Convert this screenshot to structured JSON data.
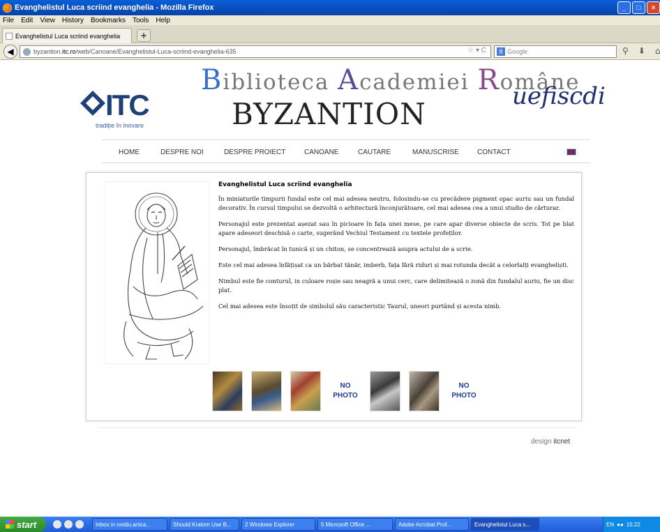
{
  "window": {
    "title": "Evanghelistul Luca scriind evanghelia - Mozilla Firefox"
  },
  "menu": [
    "File",
    "Edit",
    "View",
    "History",
    "Bookmarks",
    "Tools",
    "Help"
  ],
  "tab": {
    "label": "Evanghelistul Luca scriind evanghelia"
  },
  "url": {
    "prefix": "byzantion.",
    "domain": "itc.ro",
    "path": "/web/Canoane/Evanghelistul-Luca-scriind-evanghelia-635"
  },
  "search": {
    "placeholder": "Google"
  },
  "site": {
    "itc_logo": "ITC",
    "itc_tagline": "tradiție în inovare",
    "library": "Biblioteca Academiei Române",
    "library_caps": [
      "B",
      "A",
      "R"
    ],
    "library_rest": [
      "iblioteca ",
      "cademiei ",
      "omâne"
    ],
    "title": "BYZANTION",
    "uefiscdi": "uefiscdi"
  },
  "nav": [
    "HOME",
    "DESPRE NOI",
    "DESPRE PROIECT",
    "CANOANE",
    "CAUTARE",
    "MANUSCRISE",
    "CONTACT"
  ],
  "article": {
    "title": "Evanghelistul Luca scriind evanghelia",
    "paragraphs": [
      "În miniaturile timpurii fundal este cel mai adesea neutru, folosindu-se cu precădere pigment opac auriu sau un fundal decorativ. În cursul timpului se dezvoltă o arhitectură înconjurătoare, cel mai adesea cea a unui studio de cărturar.",
      "Personajul este prezentat așezat sau în picioare în fața unei mese, pe care apar diverse obiecte de scris. Tot pe blat apare adeseori deschisă o carte, sugerând Vechiul Testament cu textele profeților.",
      "Personajul, îmbrăcat în tunică și un chiton, se concentrează asupra actului de a scrie.",
      "Este cel mai adesea înfățișat ca un bărbat tânăr, imberb, fața fără riduri și mai rotunda decât a celorlalți evangheliști.",
      "Nimbul este fie conturul, in culoare roșie sau neagră a unui cerc, care delimitează o zonă din fundalul auriu, fie un disc plat.",
      "Cel mai adesea este însoțit de simbolul său caracteristic Taurul, uneori purtând și acesta nimb."
    ]
  },
  "thumbnails": {
    "no_photo_1": "NO PHOTO",
    "no_photo_2": "NO PHOTO"
  },
  "footer": {
    "design": "design ",
    "brand": "itcnet"
  },
  "taskbar": {
    "start": "start",
    "tasks": [
      "Inbox in ovidiu.anica...",
      "Should Kratom Use B...",
      "2 Windows Explorer",
      "5 Microsoft Office ...",
      "Adobe Acrobat Prof...",
      "Evanghelistul Luca s..."
    ],
    "lang": "EN",
    "clock": "15:22"
  }
}
